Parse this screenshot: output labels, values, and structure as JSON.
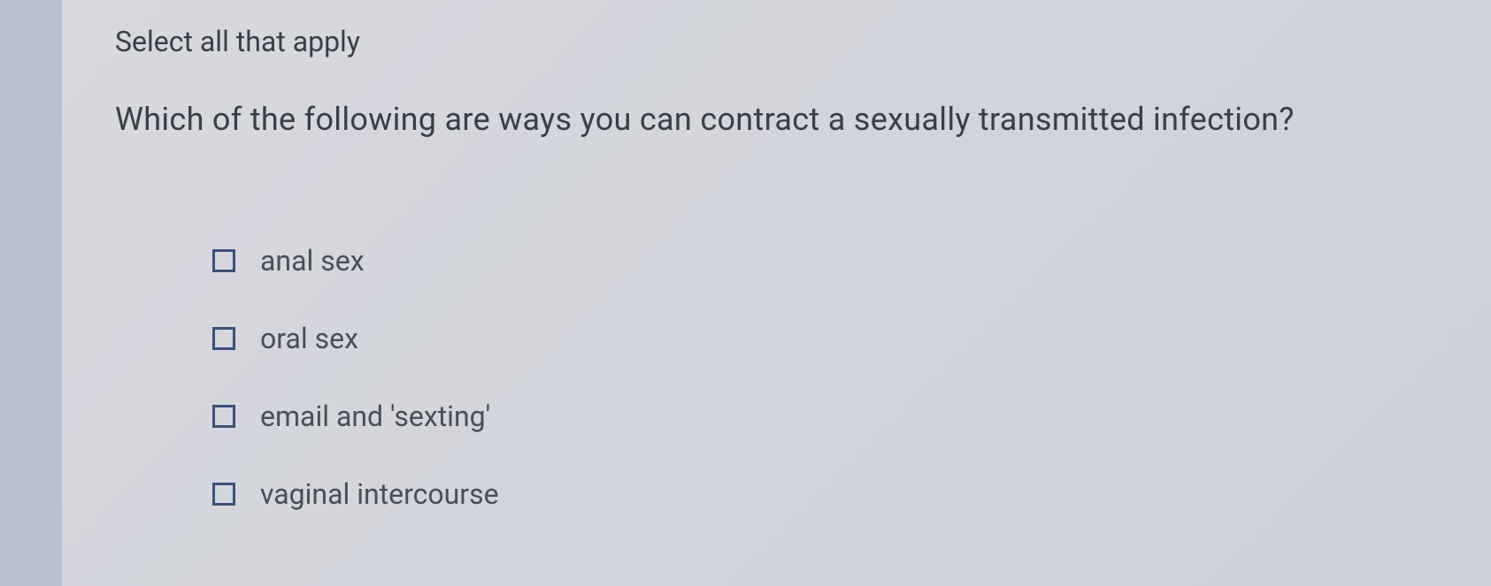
{
  "instruction": "Select all that apply",
  "question": "Which of the following are ways you can contract a sexually transmitted infection?",
  "options": [
    {
      "label": "anal sex",
      "checked": false
    },
    {
      "label": "oral sex",
      "checked": false
    },
    {
      "label": "email and 'sexting'",
      "checked": false
    },
    {
      "label": "vaginal intercourse",
      "checked": false
    }
  ]
}
